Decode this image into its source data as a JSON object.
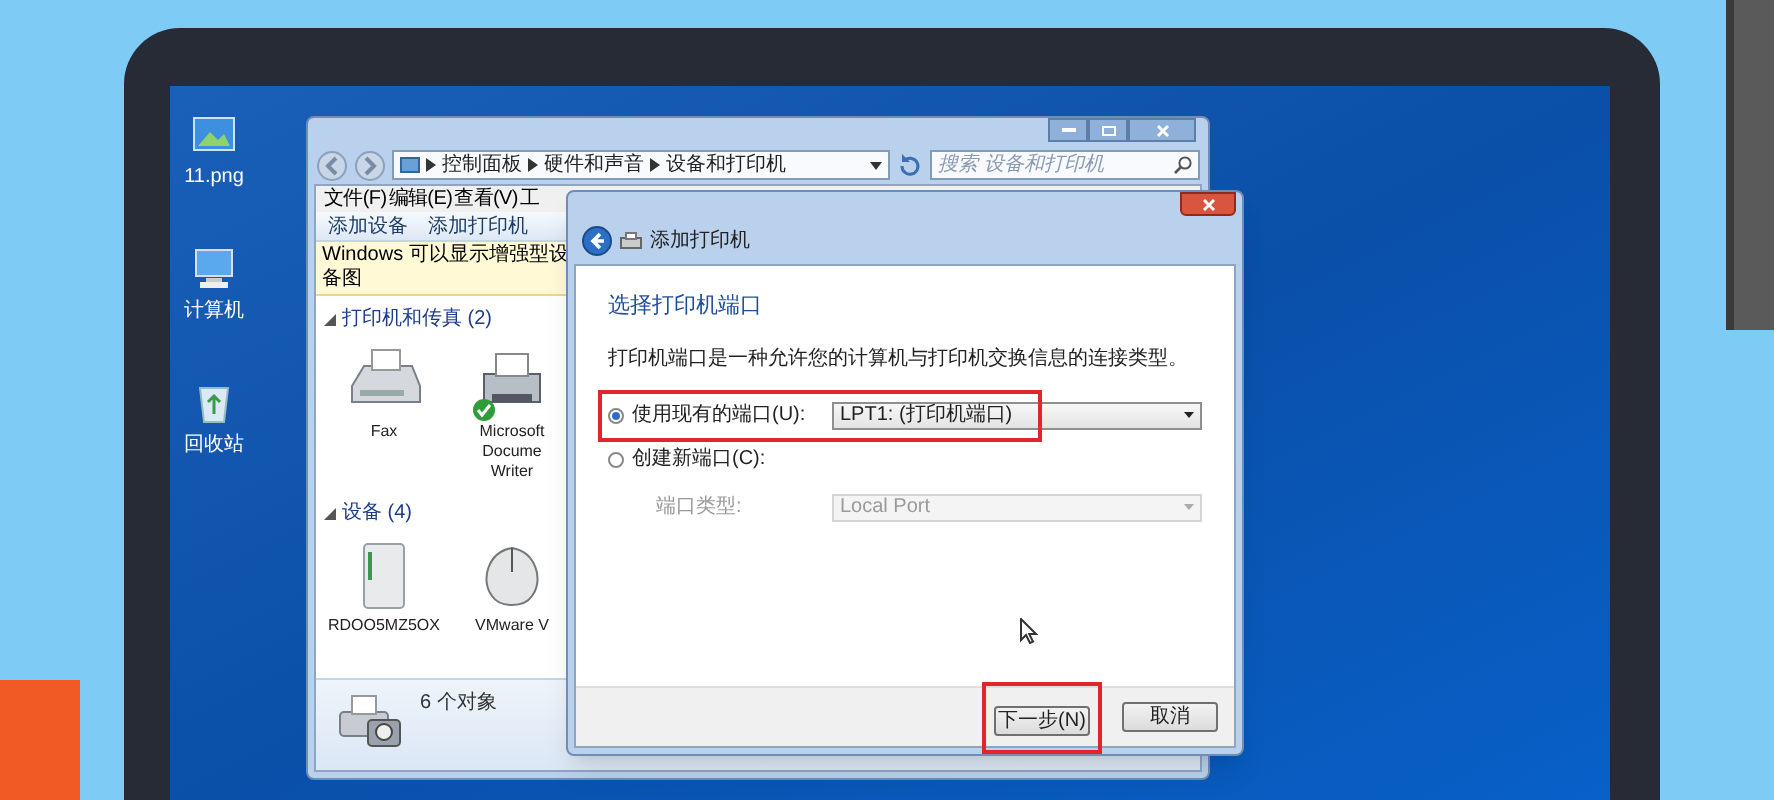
{
  "desktop_icons": [
    {
      "label": "11.png",
      "kind": "image"
    },
    {
      "label": "计算机",
      "kind": "computer"
    },
    {
      "label": "回收站",
      "kind": "recycle"
    }
  ],
  "explorer": {
    "breadcrumb": [
      "控制面板",
      "硬件和声音",
      "设备和打印机"
    ],
    "search": {
      "placeholder": "搜索 设备和打印机"
    },
    "menu": [
      "文件(F)",
      "编辑(E)",
      "查看(V)",
      "工"
    ],
    "toolbar": [
      "添加设备",
      "添加打印机"
    ],
    "info_bar": "Windows 可以显示增强型设备图",
    "groups": [
      {
        "title": "打印机和传真 (2)",
        "expanded": true,
        "items": [
          {
            "lines": [
              "Fax"
            ],
            "kind": "fax",
            "default": false
          },
          {
            "lines": [
              "Microsoft",
              "Docume",
              "Writer"
            ],
            "kind": "printer",
            "default": true
          }
        ]
      },
      {
        "title": "设备 (4)",
        "expanded": true,
        "items": [
          {
            "lines": [
              "RDOO5MZ5OX"
            ],
            "kind": "drive",
            "default": false
          },
          {
            "lines": [
              "VMware V"
            ],
            "kind": "mouse",
            "default": false
          }
        ]
      }
    ],
    "status": "6 个对象"
  },
  "dialog": {
    "title": "添加打印机",
    "heading": "选择打印机端口",
    "description": "打印机端口是一种允许您的计算机与打印机交换信息的连接类型。",
    "port_choices": [
      {
        "label": "使用现有的端口(U):",
        "selected": true,
        "highlighted": true,
        "value": "LPT1: (打印机端口)"
      },
      {
        "label": "创建新端口(C):",
        "selected": false,
        "highlighted": false
      }
    ],
    "port_type": {
      "label": "端口类型:",
      "value": "Local Port",
      "disabled": true
    },
    "buttons": [
      {
        "label": "下一步(N)",
        "highlighted": true
      },
      {
        "label": "取消",
        "highlighted": false
      }
    ]
  }
}
